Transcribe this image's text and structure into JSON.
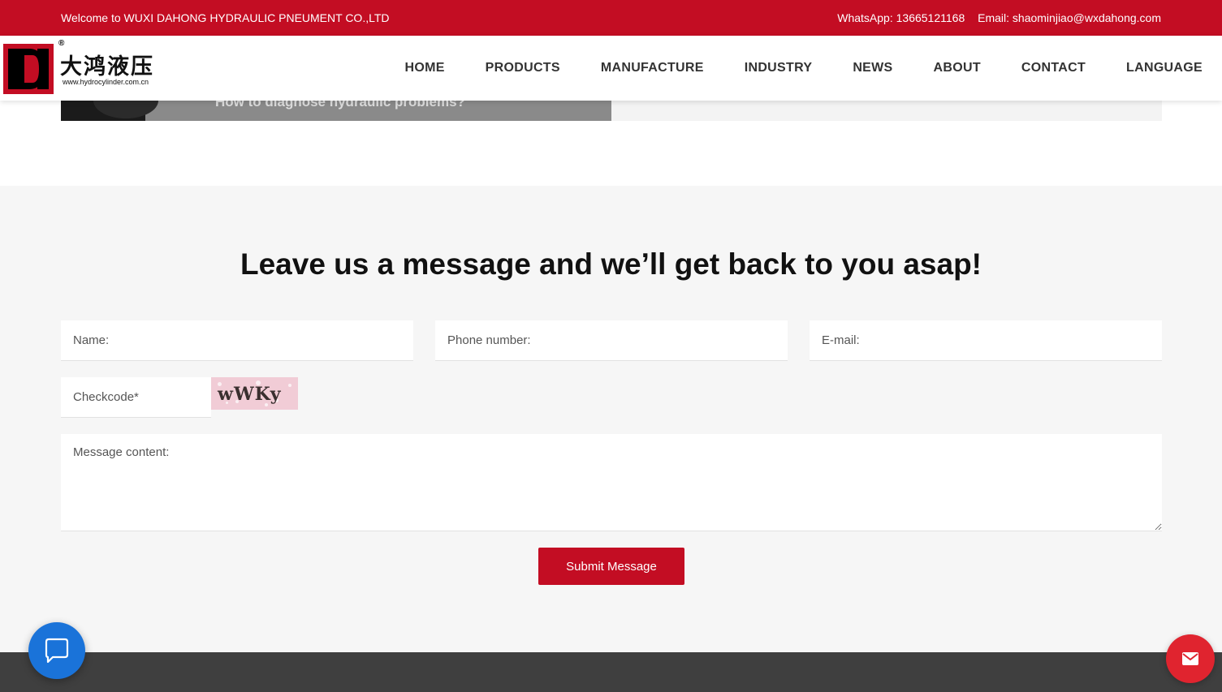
{
  "topbar": {
    "welcome": "Welcome to WUXI DAHONG HYDRAULIC PNEUMENT CO.,LTD",
    "whatsapp": "WhatsApp: 13665121168",
    "email": "Email: shaominjiao@wxdahong.com",
    "bg_color": "#c30d23"
  },
  "logo": {
    "chinese_name": "大鸿液压",
    "url": "www.hydrocylinder.com.cn",
    "registered": "®"
  },
  "nav": {
    "items": [
      "HOME",
      "PRODUCTS",
      "MANUFACTURE",
      "INDUSTRY",
      "NEWS",
      "ABOUT",
      "CONTACT",
      "LANGUAGE"
    ]
  },
  "previous_section": {
    "card_title": "How to diagnose hydraulic problems?"
  },
  "form": {
    "title": "Leave us a message and we’ll get back to you asap!",
    "name_placeholder": "Name:",
    "phone_placeholder": "Phone number:",
    "email_placeholder": "E-mail:",
    "checkcode_placeholder": "Checkcode*",
    "captcha_text": "wWKy",
    "message_placeholder": "Message content:",
    "submit_label": "Submit Message",
    "accent_color": "#c30d23"
  },
  "floating": {
    "chat_icon": "chat-bubble-icon",
    "mail_icon": "envelope-icon",
    "chat_color": "#1a73d9",
    "mail_color": "#e0242f"
  }
}
